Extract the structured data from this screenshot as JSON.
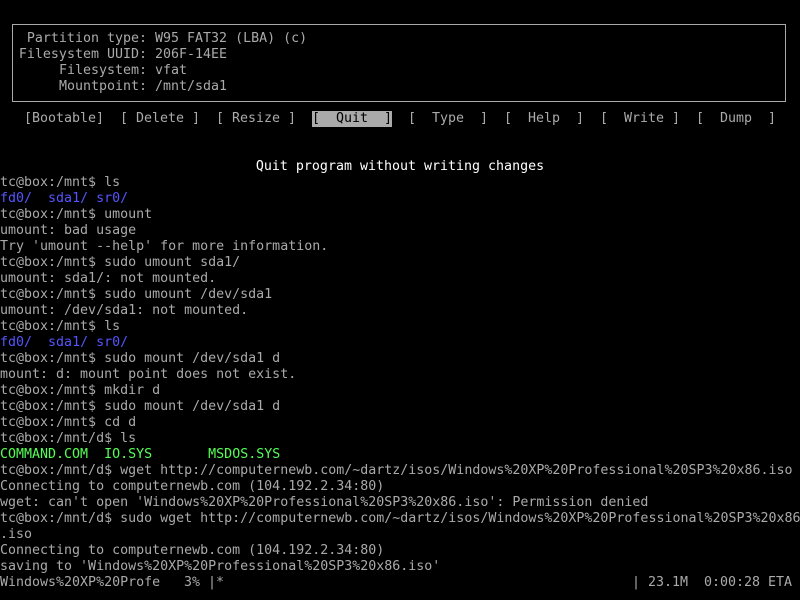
{
  "partition_info": {
    "type_label": "Partition type:",
    "type_value": "W95 FAT32 (LBA) (c)",
    "uuid_label": "Filesystem UUID:",
    "uuid_value": "206F-14EE",
    "fs_label": "Filesystem:",
    "fs_value": "vfat",
    "mount_label": "Mountpoint:",
    "mount_value": "/mnt/sda1"
  },
  "menu": {
    "bootable": "[Bootable]",
    "delete": "[ Delete ]",
    "resize": "[ Resize ]",
    "quit": "[  Quit  ]",
    "type": "[  Type  ]",
    "help": "[  Help  ]",
    "write": "[  Write ]",
    "dump": "[  Dump  ]",
    "selected": "quit"
  },
  "status_message": "Quit program without writing changes",
  "terminal": {
    "l1": "tc@box:/mnt$ ls",
    "l2_a": "fd0/",
    "l2_b": "sda1/",
    "l2_c": "sr0/",
    "l3": "tc@box:/mnt$ umount",
    "l4": "umount: bad usage",
    "l5": "Try 'umount --help' for more information.",
    "l6": "tc@box:/mnt$ sudo umount sda1/",
    "l7": "umount: sda1/: not mounted.",
    "l8": "tc@box:/mnt$ sudo umount /dev/sda1",
    "l9": "umount: /dev/sda1: not mounted.",
    "l10": "tc@box:/mnt$ ls",
    "l11_a": "fd0/",
    "l11_b": "sda1/",
    "l11_c": "sr0/",
    "l12": "tc@box:/mnt$ sudo mount /dev/sda1 d",
    "l13": "mount: d: mount point does not exist.",
    "l14": "tc@box:/mnt$ mkdir d",
    "l15": "tc@box:/mnt$ sudo mount /dev/sda1 d",
    "l16": "tc@box:/mnt$ cd d",
    "l17": "tc@box:/mnt/d$ ls",
    "l18_a": "COMMAND.COM",
    "l18_b": "IO.SYS",
    "l18_c": "MSDOS.SYS",
    "l19": "tc@box:/mnt/d$ wget http://computernewb.com/~dartz/isos/Windows%20XP%20Professional%20SP3%20x86.iso",
    "l20": "Connecting to computernewb.com (104.192.2.34:80)",
    "l21": "wget: can't open 'Windows%20XP%20Professional%20SP3%20x86.iso': Permission denied",
    "l22": "tc@box:/mnt/d$ sudo wget http://computernewb.com/~dartz/isos/Windows%20XP%20Professional%20SP3%20x86",
    "l23": ".iso",
    "l24": "Connecting to computernewb.com (104.192.2.34:80)",
    "l25": "saving to 'Windows%20XP%20Professional%20SP3%20x86.iso'"
  },
  "progress": {
    "filename": "Windows%20XP%20Profe",
    "percent": "3%",
    "bar_left": "|*",
    "bar_right": "|",
    "size": "23.1M",
    "eta": "0:00:28 ETA"
  },
  "colors": {
    "fg": "#aaaaaa",
    "bright": "#ffffff",
    "dir": "#5555ff",
    "exe": "#55ff55",
    "bg": "#000000"
  }
}
